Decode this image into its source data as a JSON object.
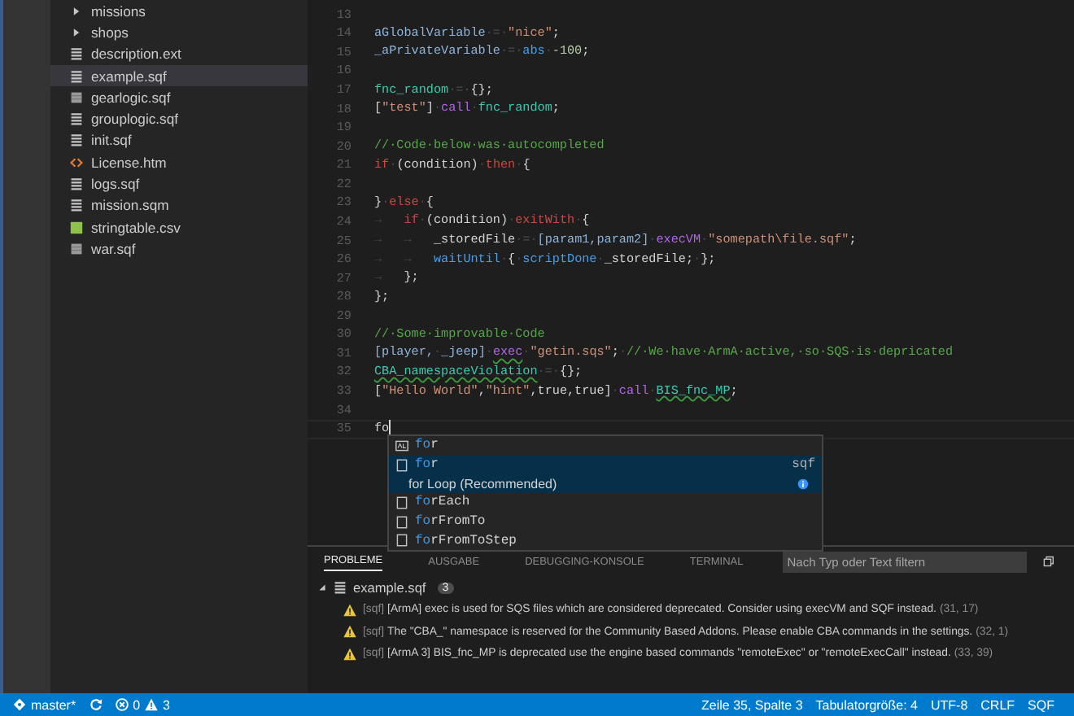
{
  "explorer": {
    "items": [
      {
        "name": "missions",
        "kind": "folder",
        "expanded": false,
        "selected": false
      },
      {
        "name": "shops",
        "kind": "folder",
        "expanded": false,
        "selected": false
      },
      {
        "name": "description.ext",
        "kind": "lines",
        "selected": false
      },
      {
        "name": "example.sqf",
        "kind": "lines",
        "selected": true
      },
      {
        "name": "gearlogic.sqf",
        "kind": "block",
        "selected": false
      },
      {
        "name": "grouplogic.sqf",
        "kind": "lines",
        "selected": false
      },
      {
        "name": "init.sqf",
        "kind": "lines",
        "selected": false
      },
      {
        "name": "License.htm",
        "kind": "code",
        "selected": false
      },
      {
        "name": "logs.sqf",
        "kind": "lines",
        "selected": false
      },
      {
        "name": "mission.sqm",
        "kind": "lines",
        "selected": false
      },
      {
        "name": "stringtable.csv",
        "kind": "sheet",
        "selected": false
      },
      {
        "name": "war.sqf",
        "kind": "block",
        "selected": false
      }
    ]
  },
  "editor": {
    "lines": [
      {
        "number": "13"
      },
      {
        "number": "14",
        "tokens": [
          {
            "text": "aGlobalVariable",
            "kind": "var"
          },
          {
            "text": "·=·",
            "kind": "ws"
          },
          {
            "text": "\"nice\"",
            "kind": "str"
          },
          {
            "text": ";",
            "kind": "plain"
          }
        ]
      },
      {
        "number": "15",
        "tokens": [
          {
            "text": "_aPrivateVariable",
            "kind": "var"
          },
          {
            "text": "·=·",
            "kind": "ws"
          },
          {
            "text": "abs",
            "kind": "cmd"
          },
          {
            "text": "·",
            "kind": "ws"
          },
          {
            "text": "-100",
            "kind": "num"
          },
          {
            "text": ";",
            "kind": "plain"
          }
        ]
      },
      {
        "number": "16"
      },
      {
        "number": "17",
        "tokens": [
          {
            "text": "fnc_random",
            "kind": "fn"
          },
          {
            "text": "·=·",
            "kind": "ws"
          },
          {
            "text": "{};",
            "kind": "plain"
          }
        ]
      },
      {
        "number": "18",
        "tokens": [
          {
            "text": "[",
            "kind": "plain"
          },
          {
            "text": "\"test\"",
            "kind": "str"
          },
          {
            "text": "]",
            "kind": "plain"
          },
          {
            "text": "·",
            "kind": "ws"
          },
          {
            "text": "call",
            "kind": "kw"
          },
          {
            "text": "·",
            "kind": "ws"
          },
          {
            "text": "fnc_random",
            "kind": "fn"
          },
          {
            "text": ";",
            "kind": "plain"
          }
        ]
      },
      {
        "number": "19"
      },
      {
        "number": "20",
        "tokens": [
          {
            "text": "//·Code·below·was·autocompleted",
            "kind": "comment"
          }
        ]
      },
      {
        "number": "21",
        "tokens": [
          {
            "text": "if",
            "kind": "ctl"
          },
          {
            "text": "·",
            "kind": "ws"
          },
          {
            "text": "(condition)",
            "kind": "plain"
          },
          {
            "text": "·",
            "kind": "ws"
          },
          {
            "text": "then",
            "kind": "ctl"
          },
          {
            "text": "·",
            "kind": "ws"
          },
          {
            "text": "{",
            "kind": "plain"
          }
        ]
      },
      {
        "number": "22"
      },
      {
        "number": "23",
        "tokens": [
          {
            "text": "}",
            "kind": "plain"
          },
          {
            "text": "·",
            "kind": "ws"
          },
          {
            "text": "else",
            "kind": "ctl"
          },
          {
            "text": "·",
            "kind": "ws"
          },
          {
            "text": "{",
            "kind": "plain"
          }
        ]
      },
      {
        "number": "24",
        "tokens": [
          {
            "text": "→   ",
            "kind": "ws"
          },
          {
            "text": "if",
            "kind": "ctl"
          },
          {
            "text": "·",
            "kind": "ws"
          },
          {
            "text": "(condition)",
            "kind": "plain"
          },
          {
            "text": "·",
            "kind": "ws"
          },
          {
            "text": "exitWith",
            "kind": "ctl"
          },
          {
            "text": "·",
            "kind": "ws"
          },
          {
            "text": "{",
            "kind": "plain"
          }
        ]
      },
      {
        "number": "25",
        "tokens": [
          {
            "text": "→   →   ",
            "kind": "ws"
          },
          {
            "text": "_storedFile",
            "kind": "plain"
          },
          {
            "text": "·=·",
            "kind": "ws"
          },
          {
            "text": "[param1,param2]",
            "kind": "var"
          },
          {
            "text": "·",
            "kind": "ws"
          },
          {
            "text": "execVM",
            "kind": "kw"
          },
          {
            "text": "·",
            "kind": "ws"
          },
          {
            "text": "\"somepath\\file.sqf\"",
            "kind": "str"
          },
          {
            "text": ";",
            "kind": "plain"
          }
        ]
      },
      {
        "number": "26",
        "tokens": [
          {
            "text": "→   →   ",
            "kind": "ws"
          },
          {
            "text": "waitUntil",
            "kind": "cmd"
          },
          {
            "text": "·",
            "kind": "ws"
          },
          {
            "text": "{",
            "kind": "plain"
          },
          {
            "text": "·",
            "kind": "ws"
          },
          {
            "text": "scriptDone",
            "kind": "cmd"
          },
          {
            "text": "·",
            "kind": "ws"
          },
          {
            "text": "_storedFile;",
            "kind": "plain"
          },
          {
            "text": "·",
            "kind": "ws"
          },
          {
            "text": "};",
            "kind": "plain"
          }
        ]
      },
      {
        "number": "27",
        "tokens": [
          {
            "text": "→   ",
            "kind": "ws"
          },
          {
            "text": "};",
            "kind": "plain"
          }
        ]
      },
      {
        "number": "28",
        "tokens": [
          {
            "text": "};",
            "kind": "plain"
          }
        ]
      },
      {
        "number": "29"
      },
      {
        "number": "30",
        "tokens": [
          {
            "text": "//·Some·improvable·Code",
            "kind": "comment"
          }
        ]
      },
      {
        "number": "31",
        "tokens": [
          {
            "text": "[player,",
            "kind": "var"
          },
          {
            "text": "·",
            "kind": "ws"
          },
          {
            "text": "_jeep]",
            "kind": "var"
          },
          {
            "text": "·",
            "kind": "ws"
          },
          {
            "text": "exec",
            "kind": "kw",
            "warn": true
          },
          {
            "text": "·",
            "kind": "ws"
          },
          {
            "text": "\"getin.sqs\"",
            "kind": "str"
          },
          {
            "text": ";",
            "kind": "plain"
          },
          {
            "text": "·",
            "kind": "ws"
          },
          {
            "text": "//·We·have·ArmA·active,·so·SQS·is·depricated",
            "kind": "comment"
          }
        ]
      },
      {
        "number": "32",
        "tokens": [
          {
            "text": "CBA_namespaceViolation",
            "kind": "fn",
            "warn": true
          },
          {
            "text": "·=·",
            "kind": "ws"
          },
          {
            "text": "{};",
            "kind": "plain"
          }
        ]
      },
      {
        "number": "33",
        "tokens": [
          {
            "text": "[",
            "kind": "plain"
          },
          {
            "text": "\"Hello World\"",
            "kind": "str"
          },
          {
            "text": ",",
            "kind": "plain"
          },
          {
            "text": "\"hint\"",
            "kind": "str"
          },
          {
            "text": ",true,true]",
            "kind": "plain"
          },
          {
            "text": "·",
            "kind": "ws"
          },
          {
            "text": "call",
            "kind": "kw"
          },
          {
            "text": "·",
            "kind": "ws"
          },
          {
            "text": "BIS_fnc_MP",
            "kind": "fn",
            "warn": true
          },
          {
            "text": ";",
            "kind": "plain"
          }
        ]
      },
      {
        "number": "34"
      },
      {
        "number": "35",
        "current": true,
        "tokens": [
          {
            "text": "fo",
            "kind": "plain"
          }
        ]
      }
    ]
  },
  "suggestions": [
    {
      "kind": "text",
      "match": "fo",
      "rest": "r",
      "selected": false
    },
    {
      "kind": "snippet",
      "match": "fo",
      "rest": "r",
      "detail": "sqf",
      "description": "for Loop (Recommended)",
      "selected": true
    },
    {
      "kind": "snippet",
      "match": "fo",
      "rest": "rEach",
      "selected": false
    },
    {
      "kind": "snippet",
      "match": "fo",
      "rest": "rFromTo",
      "selected": false
    },
    {
      "kind": "snippet",
      "match": "fo",
      "rest": "rFromToStep",
      "selected": false
    }
  ],
  "panel": {
    "tabs": [
      {
        "label": "PROBLEME",
        "selected": true
      },
      {
        "label": "AUSGABE",
        "selected": false
      },
      {
        "label": "DEBUGGING-KONSOLE",
        "selected": false
      },
      {
        "label": "TERMINAL",
        "selected": false
      }
    ],
    "filter": {
      "placeholder": "Nach Typ oder Text filtern"
    },
    "file": {
      "name": "example.sqf",
      "count": "3",
      "expanded": true
    },
    "problems": [
      {
        "source": "[sqf]",
        "message": "[ArmA] exec is used for SQS files which are considered deprecated. Consider using execVM and SQF instead.",
        "location": "(31, 17)"
      },
      {
        "source": "[sqf]",
        "message": "The \"CBA_\" namespace is reserved for the Community Based Addons. Please enable CBA commands in the settings.",
        "location": "(32, 1)"
      },
      {
        "source": "[sqf]",
        "message": "[ArmA 3] BIS_fnc_MP is deprecated use the engine based commands \"remoteExec\" or \"remoteExecCall\" instead.",
        "location": "(33, 39)"
      }
    ]
  },
  "status_bar": {
    "branch": "master*",
    "errors": "0",
    "warnings": "3",
    "items": [
      "Zeile 35, Spalte 3",
      "Tabulatorgröße: 4",
      "UTF-8",
      "CRLF",
      "SQF"
    ]
  }
}
